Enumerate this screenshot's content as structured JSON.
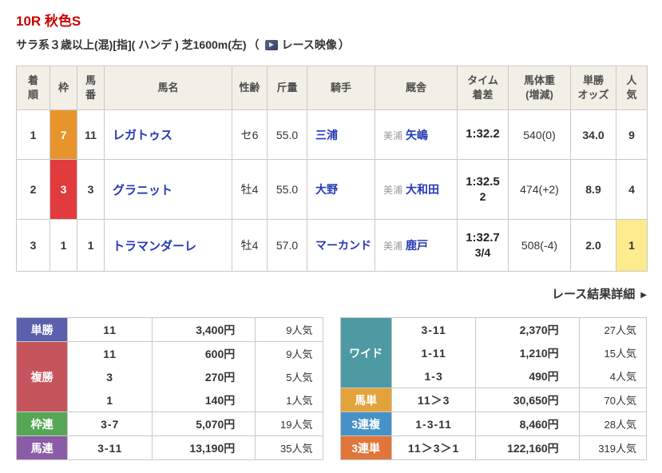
{
  "header": {
    "title": "10R 秋色S",
    "conditions": "サラ系３歳以上(混)[指]( ハンデ ) 芝1600m(左)",
    "video_open": "（",
    "video_label": "レース映像",
    "video_close": "）"
  },
  "icons": {
    "detail_arrow": "▶"
  },
  "results": {
    "headers": {
      "finish": "着\n順",
      "frame": "枠",
      "horse_number": "馬\n番",
      "horse_name": "馬名",
      "sex_age": "性齢",
      "weight": "斤量",
      "jockey": "騎手",
      "stable": "厩舎",
      "time_margin": "タイム\n着差",
      "horse_weight": "馬体重\n(増減)",
      "odds": "単勝\nオッズ",
      "popularity": "人\n気"
    },
    "rows": [
      {
        "finish": "1",
        "frame": "7",
        "frame_bg": "#e8942d",
        "frame_fg": "#ffffff",
        "horse_number": "11",
        "horse_name": "レガトゥス",
        "sex_age": "セ6",
        "weight": "55.0",
        "jockey": "三浦",
        "region": "美浦",
        "trainer": "矢嶋",
        "time": "1:32.2",
        "margin": "",
        "horse_weight": "540(0)",
        "odds": "34.0",
        "popularity": "9",
        "popularity_bg": ""
      },
      {
        "finish": "2",
        "frame": "3",
        "frame_bg": "#e23b3e",
        "frame_fg": "#ffffff",
        "horse_number": "3",
        "horse_name": "グラニット",
        "sex_age": "牡4",
        "weight": "55.0",
        "jockey": "大野",
        "region": "美浦",
        "trainer": "大和田",
        "time": "1:32.5",
        "margin": "2",
        "horse_weight": "474(+2)",
        "odds": "8.9",
        "popularity": "4",
        "popularity_bg": ""
      },
      {
        "finish": "3",
        "frame": "1",
        "frame_bg": "",
        "frame_fg": "",
        "horse_number": "1",
        "horse_name": "トラマンダーレ",
        "sex_age": "牡4",
        "weight": "57.0",
        "jockey": "マーカンド",
        "region": "美浦",
        "trainer": "鹿戸",
        "time": "1:32.7",
        "margin": "3/4",
        "horse_weight": "508(-4)",
        "odds": "2.0",
        "popularity": "1",
        "popularity_bg": "#fdeb8d"
      }
    ]
  },
  "detail_link": {
    "label": "レース結果詳細"
  },
  "payouts_left": {
    "groups": [
      {
        "label": "単勝",
        "color": "#5a5fae",
        "rows": [
          {
            "combo": "11",
            "amount": "3,400円",
            "popularity": "9人気"
          }
        ]
      },
      {
        "label": "複勝",
        "color": "#c5545c",
        "rows": [
          {
            "combo": "11",
            "amount": "600円",
            "popularity": "9人気"
          },
          {
            "combo": "3",
            "amount": "270円",
            "popularity": "5人気"
          },
          {
            "combo": "1",
            "amount": "140円",
            "popularity": "1人気"
          }
        ]
      },
      {
        "label": "枠連",
        "color": "#55a755",
        "rows": [
          {
            "combo": "3-7",
            "amount": "5,070円",
            "popularity": "19人気"
          }
        ]
      },
      {
        "label": "馬連",
        "color": "#8a5ca6",
        "rows": [
          {
            "combo": "3-11",
            "amount": "13,190円",
            "popularity": "35人気"
          }
        ]
      }
    ]
  },
  "payouts_right": {
    "groups": [
      {
        "label": "ワイド",
        "color": "#4e9aa2",
        "rows": [
          {
            "combo": "3-11",
            "amount": "2,370円",
            "popularity": "27人気"
          },
          {
            "combo": "1-11",
            "amount": "1,210円",
            "popularity": "15人気"
          },
          {
            "combo": "1-3",
            "amount": "490円",
            "popularity": "4人気"
          }
        ]
      },
      {
        "label": "馬単",
        "color": "#e3a33b",
        "rows": [
          {
            "combo": "11＞3",
            "amount": "30,650円",
            "popularity": "70人気"
          }
        ]
      },
      {
        "label": "3連複",
        "color": "#4691c5",
        "rows": [
          {
            "combo": "1-3-11",
            "amount": "8,460円",
            "popularity": "28人気"
          }
        ]
      },
      {
        "label": "3連単",
        "color": "#e0763a",
        "rows": [
          {
            "combo": "11＞3＞1",
            "amount": "122,160円",
            "popularity": "319人気"
          }
        ]
      }
    ]
  }
}
